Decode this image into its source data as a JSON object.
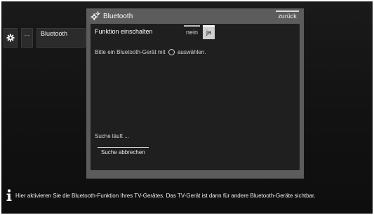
{
  "breadcrumb": {
    "more_label": "...",
    "current_label": "Bluetooth"
  },
  "dialog": {
    "title": "Bluetooth",
    "back_label": "zurück",
    "function_label": "Funktion einschalten",
    "toggle_no": "nein",
    "toggle_yes": "ja",
    "toggle_selected": "ja",
    "hint_before": "Bitte ein Bluetooth-Gerät mit",
    "hint_after": "auswählen.",
    "status_text": "Suche läuft ...",
    "cancel_label": "Suche abbrechen"
  },
  "footer": {
    "info_text": "Hier aktivieren Sie die Bluetooth-Funktion Ihres TV-Gerätes. Das TV-Gerät ist dann für andere Bluetooth-Geräte sichtbar."
  },
  "colors": {
    "screen_bg": "#141414",
    "dialog_frame": "#5c5c5c",
    "dialog_body": "#1f1f1f",
    "selected_toggle": "#d0d0d0"
  },
  "icons": {
    "settings": "gear-icon",
    "dialog": "settings-gears-icon",
    "ok_button": "ok-button-icon",
    "info": "info-icon"
  }
}
